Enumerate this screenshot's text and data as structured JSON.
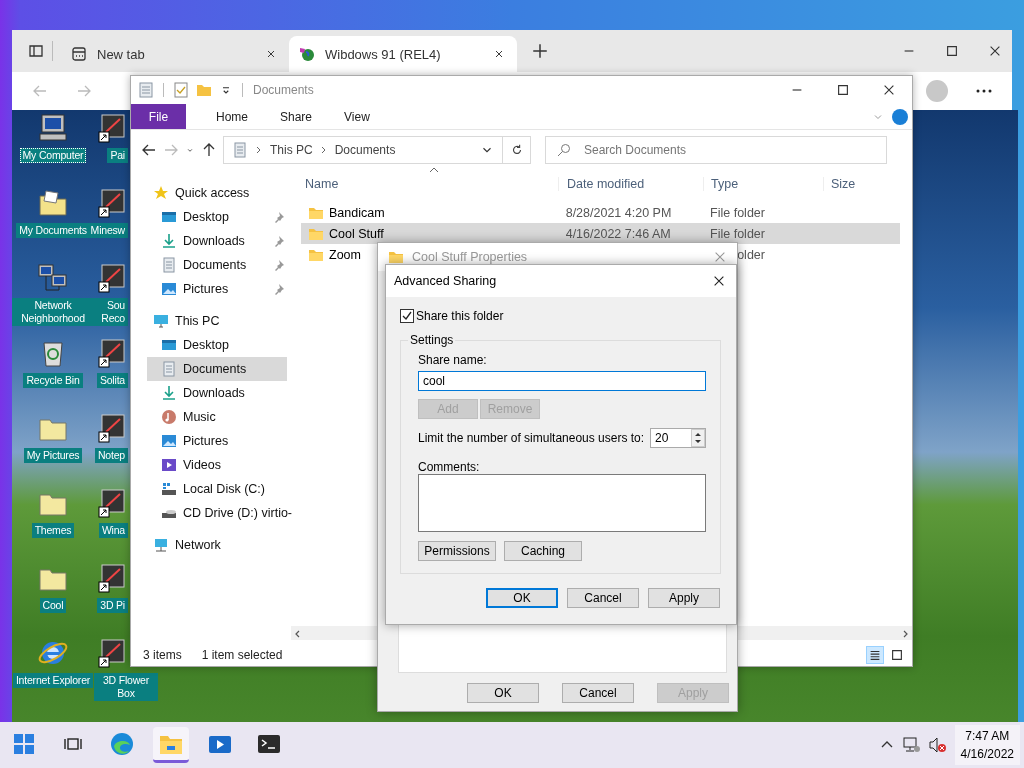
{
  "browser": {
    "tabs": [
      {
        "title": "New tab",
        "kind": "newtab",
        "selected": false
      },
      {
        "title": "Wibdows 91 (REL4)",
        "kind": "site",
        "selected": true
      }
    ]
  },
  "desktop_icons": [
    {
      "label": "My Computer",
      "kind": "computer",
      "partial": false,
      "selected": true
    },
    {
      "label": "Pai",
      "kind": "app",
      "partial": true,
      "selected": false
    },
    {
      "label": "My Documents",
      "kind": "docs",
      "partial": false,
      "selected": false
    },
    {
      "label": "Minesw",
      "kind": "app",
      "partial": true,
      "selected": false
    },
    {
      "label": "Network Neighborhood",
      "kind": "network",
      "partial": false,
      "selected": false
    },
    {
      "label": "Sou Reco",
      "kind": "app",
      "partial": true,
      "selected": false
    },
    {
      "label": "Recycle Bin",
      "kind": "bin",
      "partial": false,
      "selected": false
    },
    {
      "label": "Solita",
      "kind": "app",
      "partial": true,
      "selected": false
    },
    {
      "label": "My Pictures",
      "kind": "folder",
      "partial": false,
      "selected": false
    },
    {
      "label": "Notep",
      "kind": "app",
      "partial": true,
      "selected": false
    },
    {
      "label": "Themes",
      "kind": "folder",
      "partial": false,
      "selected": false
    },
    {
      "label": "Wina",
      "kind": "app",
      "partial": true,
      "selected": false
    },
    {
      "label": "Cool",
      "kind": "folder",
      "partial": false,
      "selected": false
    },
    {
      "label": "3D Pi",
      "kind": "app",
      "partial": true,
      "selected": false
    },
    {
      "label": "Internet Explorer",
      "kind": "browser",
      "partial": false,
      "selected": false
    },
    {
      "label": "3D Flower Box",
      "kind": "app",
      "partial": false,
      "selected": false
    }
  ],
  "explorer": {
    "title": "Documents",
    "ribbon_tabs": [
      {
        "label": "File",
        "kind": "file"
      },
      {
        "label": "Home",
        "kind": "tab"
      },
      {
        "label": "Share",
        "kind": "tab"
      },
      {
        "label": "View",
        "kind": "tab"
      }
    ],
    "breadcrumb": [
      "This PC",
      "Documents"
    ],
    "search": {
      "placeholder": "Search Documents"
    },
    "nav": [
      {
        "label": "Quick access",
        "kind": "star",
        "selected": false,
        "pinned": false,
        "children": [
          {
            "label": "Desktop",
            "kind": "desktop",
            "pinned": true,
            "selected": false
          },
          {
            "label": "Downloads",
            "kind": "download",
            "pinned": true,
            "selected": false
          },
          {
            "label": "Documents",
            "kind": "document",
            "pinned": true,
            "selected": false
          },
          {
            "label": "Pictures",
            "kind": "picture",
            "pinned": true,
            "selected": false
          }
        ]
      },
      {
        "label": "This PC",
        "kind": "pc",
        "selected": false,
        "pinned": false,
        "children": [
          {
            "label": "Desktop",
            "kind": "desktop",
            "pinned": false,
            "selected": false
          },
          {
            "label": "Documents",
            "kind": "document",
            "pinned": false,
            "selected": true
          },
          {
            "label": "Downloads",
            "kind": "download",
            "pinned": false,
            "selected": false
          },
          {
            "label": "Music",
            "kind": "music",
            "pinned": false,
            "selected": false
          },
          {
            "label": "Pictures",
            "kind": "picture",
            "pinned": false,
            "selected": false
          },
          {
            "label": "Videos",
            "kind": "video",
            "pinned": false,
            "selected": false
          },
          {
            "label": "Local Disk (C:)",
            "kind": "disk",
            "pinned": false,
            "selected": false
          },
          {
            "label": "CD Drive (D:) virtio-",
            "kind": "cd",
            "pinned": false,
            "selected": false
          }
        ]
      },
      {
        "label": "Network",
        "kind": "network",
        "selected": false,
        "pinned": false
      }
    ],
    "columns": [
      "Name",
      "Date modified",
      "Type",
      "Size"
    ],
    "rows": [
      {
        "name": "Bandicam",
        "date": "8/28/2021 4:20 PM",
        "type": "File folder",
        "selected": false
      },
      {
        "name": "Cool Stuff",
        "date": "4/16/2022 7:46 AM",
        "type": "File folder",
        "selected": true
      },
      {
        "name": "Zoom",
        "type": "older",
        "selected": false
      }
    ],
    "status": [
      "3 items",
      "1 item selected"
    ],
    "views": [
      {
        "kind": "details",
        "selected": true
      },
      {
        "kind": "tiles",
        "selected": false
      }
    ]
  },
  "properties": {
    "title": "Cool Stuff Properties",
    "buttons": [
      {
        "label": "OK",
        "default": false,
        "disabled": false
      },
      {
        "label": "Cancel",
        "default": false,
        "disabled": false
      },
      {
        "label": "Apply",
        "default": false,
        "disabled": true
      }
    ]
  },
  "sharing": {
    "title": "Advanced Sharing",
    "share_checkbox": {
      "label": "Share this folder",
      "checked": true
    },
    "group_title": "Settings",
    "share_name": {
      "label": "Share name:",
      "value": "cool"
    },
    "name_buttons": [
      {
        "label": "Add",
        "default": false,
        "disabled": true
      },
      {
        "label": "Remove",
        "default": false,
        "disabled": true
      }
    ],
    "limit": {
      "label": "Limit the number of simultaneous users to:",
      "value": "20"
    },
    "comments": {
      "label": "Comments:"
    },
    "extra_buttons": [
      {
        "label": "Permissions",
        "default": false,
        "disabled": false
      },
      {
        "label": "Caching",
        "default": false,
        "disabled": false
      }
    ],
    "buttons": [
      {
        "label": "OK",
        "default": true,
        "disabled": false
      },
      {
        "label": "Cancel",
        "default": false,
        "disabled": false
      },
      {
        "label": "Apply",
        "default": false,
        "disabled": false
      }
    ]
  },
  "taskbar": {
    "apps": [
      {
        "kind": "start",
        "active": false
      },
      {
        "kind": "taskview",
        "active": false
      },
      {
        "kind": "edge",
        "active": false
      },
      {
        "kind": "explorer",
        "active": true
      },
      {
        "kind": "media",
        "active": false
      },
      {
        "kind": "terminal",
        "active": false
      }
    ],
    "time": "7:47 AM",
    "date": "4/16/2022"
  }
}
